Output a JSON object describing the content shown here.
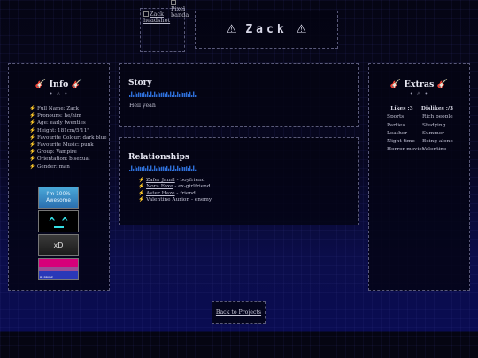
{
  "header": {
    "headshot_alt": "Zack headshot",
    "banner_alt": "Pixel banda",
    "name": "Zack",
    "warn_icon": "⚠"
  },
  "info": {
    "title": "Info",
    "guitar_icon": "🎸",
    "divider": "• ⚠ •",
    "bullet": "⚡",
    "facts": [
      "Full Name: Zack",
      "Pronouns: he/him",
      "Age: early twenties",
      "Height: 181cm/5'11\"",
      "Favourite Colour: dark blue",
      "Favourite Music: punk",
      "Group: Vampire",
      "Orientation: bisexual",
      "Gender: man"
    ],
    "stamps": {
      "s1_line1": "I'm 100%",
      "s1_line2": "Awesome",
      "s2_eyes": "^ ^",
      "s3_text": "xD",
      "s4_text": "BI PRIDE"
    }
  },
  "story": {
    "title": "Story",
    "text": "Hell yeah"
  },
  "relationships": {
    "title": "Relationships",
    "bullet": "⚡",
    "items": [
      {
        "name": "Zafer Jamil",
        "rel": " - boyfriend"
      },
      {
        "name": "Nora Foxe",
        "rel": " - ex-girlfriend"
      },
      {
        "name": "Aster Haze",
        "rel": " - friend"
      },
      {
        "name": "Valentine Aurion",
        "rel": " - enemy"
      }
    ]
  },
  "extras": {
    "title": "Extras",
    "guitar_icon": "🎸",
    "divider": "• ⚠ •",
    "likes_header": "Likes :3",
    "dislikes_header": "Dislikes :/3",
    "likes": [
      "Sports",
      "Parties",
      "Leather",
      "Night-time",
      "Horror movies"
    ],
    "dislikes": [
      "Rich people",
      "Studying",
      "Summer",
      "Being alone",
      "Valentine"
    ]
  },
  "footer": {
    "back_link": "Back to Projects"
  },
  "colors": {
    "accent": "#2e6fd8",
    "border": "#5a5a7a"
  }
}
